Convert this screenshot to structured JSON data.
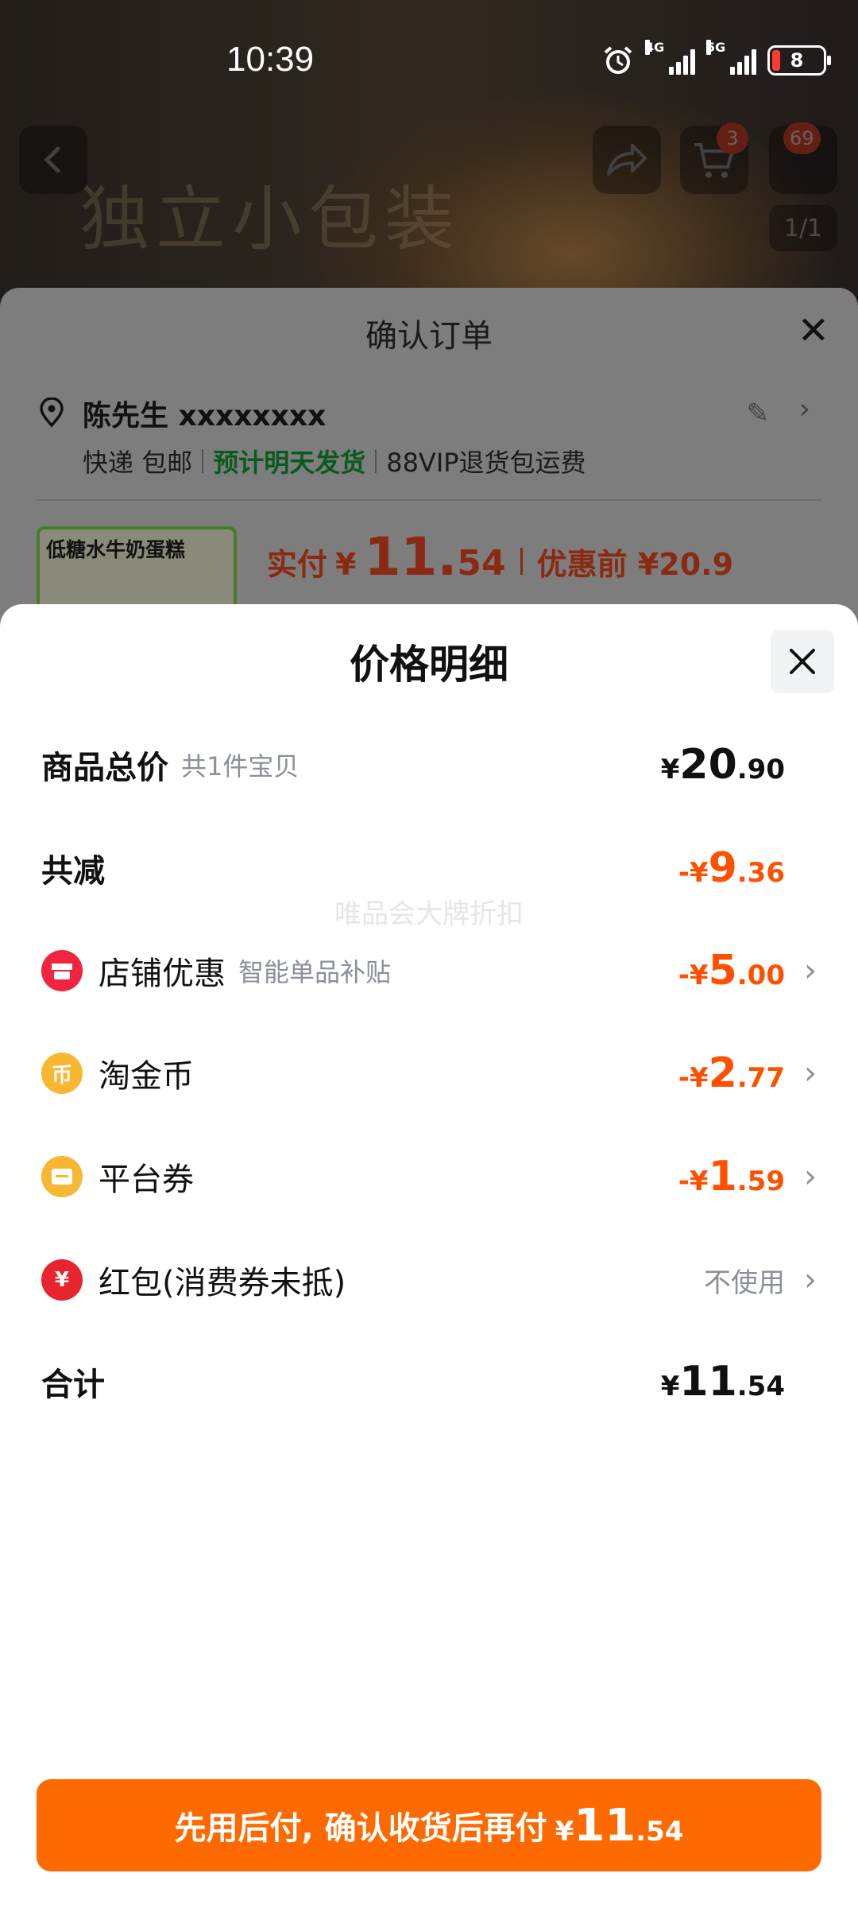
{
  "status_bar": {
    "time": "10:39",
    "network_1": "4G",
    "network_2": "5G",
    "battery": "8"
  },
  "background_page": {
    "promo_text": "独立小包装",
    "cart_badge": "3",
    "message_badge": "69",
    "pager": "1/1"
  },
  "order_sheet": {
    "title": "确认订单",
    "address_name": "陈先生 xxxxxxxx",
    "shipping": "快递 包邮",
    "ship_estimate": "预计明天发货",
    "return_policy": "88VIP退货包运费",
    "product_thumb_title": "低糖水牛奶蛋糕",
    "pay_label": "实付",
    "pay_currency": "¥",
    "pay_int": "11.",
    "pay_dec": "54",
    "pre_discount": "优惠前 ¥20.9"
  },
  "price_detail": {
    "title": "价格明细",
    "watermark": "唯品会大牌折扣",
    "rows": [
      {
        "label": "商品总价",
        "sub": "共1件宝贝",
        "currency": "¥",
        "int": "20",
        "dec": ".90",
        "style": "dark"
      },
      {
        "label": "共减",
        "sub": "",
        "currency": "-¥",
        "int": "9",
        "dec": ".36",
        "style": "orange"
      },
      {
        "label": "店铺优惠",
        "sub": "智能单品补贴",
        "currency": "-¥",
        "int": "5",
        "dec": ".00",
        "style": "orange",
        "icon": "shop-icon"
      },
      {
        "label": "淘金币",
        "sub": "",
        "currency": "-¥",
        "int": "2",
        "dec": ".77",
        "style": "orange",
        "icon": "coin-icon",
        "icon_glyph": "币"
      },
      {
        "label": "平台券",
        "sub": "",
        "currency": "-¥",
        "int": "1",
        "dec": ".59",
        "style": "orange",
        "icon": "coupon-icon"
      },
      {
        "label": "红包(消费券未抵)",
        "sub": "",
        "value_text": "不使用",
        "icon": "red-packet-icon",
        "icon_glyph": "¥"
      },
      {
        "label": "合计",
        "sub": "",
        "currency": "¥",
        "int": "11",
        "dec": ".54",
        "style": "dark"
      }
    ]
  },
  "pay_button": {
    "label": "先用后付, 确认收货后再付",
    "currency": "¥",
    "int": "11",
    "dec": ".54"
  },
  "colors": {
    "accent_orange": "#ff5000",
    "button_orange": "#ff6a00",
    "green": "#0a5a1f"
  }
}
